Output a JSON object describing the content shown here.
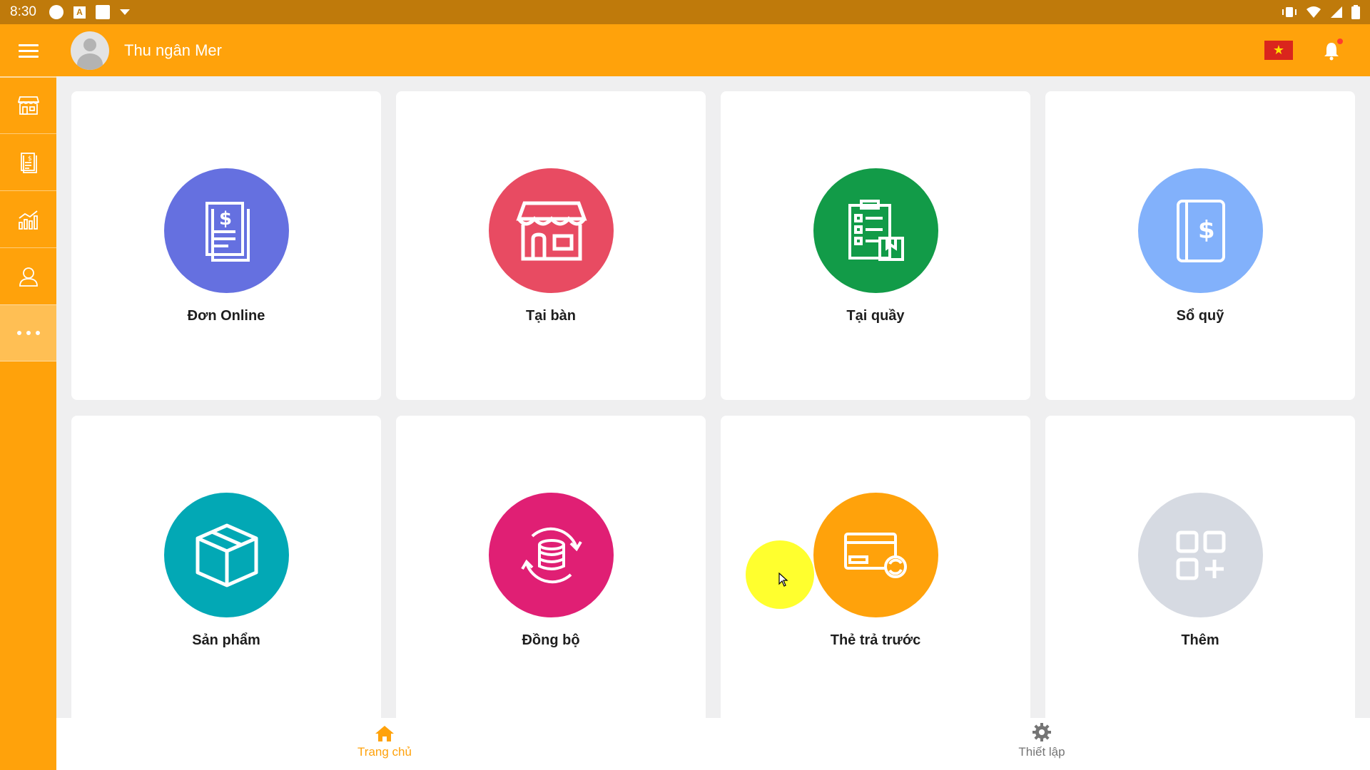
{
  "status_bar": {
    "time": "8:30",
    "app_icon_letter": "A"
  },
  "header": {
    "user_name": "Thu ngân Mer",
    "language_flag": "★"
  },
  "sidebar": {
    "items": [
      {
        "icon": "store-icon"
      },
      {
        "icon": "receipt-icon"
      },
      {
        "icon": "report-chart-icon"
      },
      {
        "icon": "person-icon"
      },
      {
        "icon": "more-dots-icon",
        "active": true
      }
    ]
  },
  "tiles": [
    {
      "label": "Đơn Online",
      "icon": "invoice-dollar-icon",
      "color": "#6570e0"
    },
    {
      "label": "Tại bàn",
      "icon": "storefront-icon",
      "color": "#e84b62"
    },
    {
      "label": "Tại quầy",
      "icon": "clipboard-list-icon",
      "color": "#129b48"
    },
    {
      "label": "Sổ quỹ",
      "icon": "cashbook-icon",
      "color": "#82b1fb"
    },
    {
      "label": "Sản phẩm",
      "icon": "box-icon",
      "color": "#02a8b5"
    },
    {
      "label": "Đồng bộ",
      "icon": "sync-database-icon",
      "color": "#e01f74"
    },
    {
      "label": "Thẻ trả trước",
      "icon": "prepaid-card-icon",
      "color": "#ffa20b"
    },
    {
      "label": "Thêm",
      "icon": "add-apps-icon",
      "color": "#d6dae2"
    }
  ],
  "bottom_nav": {
    "home": {
      "label": "Trang chủ",
      "active": true
    },
    "settings": {
      "label": "Thiết lập",
      "active": false
    }
  },
  "colors": {
    "primary": "#ffa20b",
    "status_bar": "#bf7a0b",
    "inactive": "#757575"
  }
}
